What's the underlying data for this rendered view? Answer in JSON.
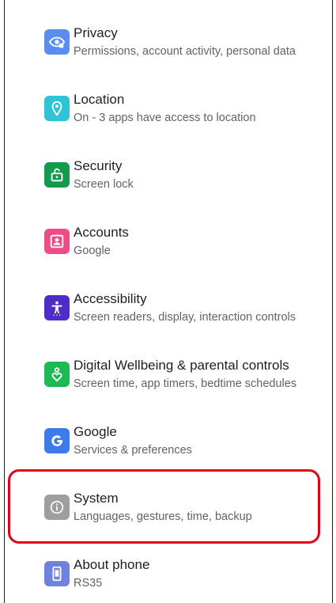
{
  "settings": {
    "items": [
      {
        "title": "Privacy",
        "subtitle": "Permissions, account activity, personal data",
        "icon": "privacy-eye-icon",
        "color": "#5B8DEF"
      },
      {
        "title": "Location",
        "subtitle": "On - 3 apps have access to location",
        "icon": "location-pin-icon",
        "color": "#2EC4D6"
      },
      {
        "title": "Security",
        "subtitle": "Screen lock",
        "icon": "lock-icon",
        "color": "#139B4D"
      },
      {
        "title": "Accounts",
        "subtitle": "Google",
        "icon": "account-icon",
        "color": "#EE4C86"
      },
      {
        "title": "Accessibility",
        "subtitle": "Screen readers, display, interaction controls",
        "icon": "accessibility-icon",
        "color": "#4D2CC8"
      },
      {
        "title": "Digital Wellbeing & parental controls",
        "subtitle": "Screen time, app timers, bedtime schedules",
        "icon": "wellbeing-heart-icon",
        "color": "#1DB954"
      },
      {
        "title": "Google",
        "subtitle": "Services & preferences",
        "icon": "google-g-icon",
        "color": "#3C7BEA"
      },
      {
        "title": "System",
        "subtitle": "Languages, gestures, time, backup",
        "icon": "info-icon",
        "color": "#9E9E9E"
      },
      {
        "title": "About phone",
        "subtitle": "RS35",
        "icon": "phone-icon",
        "color": "#7082E0"
      }
    ]
  },
  "highlight_color": "#E0001A"
}
